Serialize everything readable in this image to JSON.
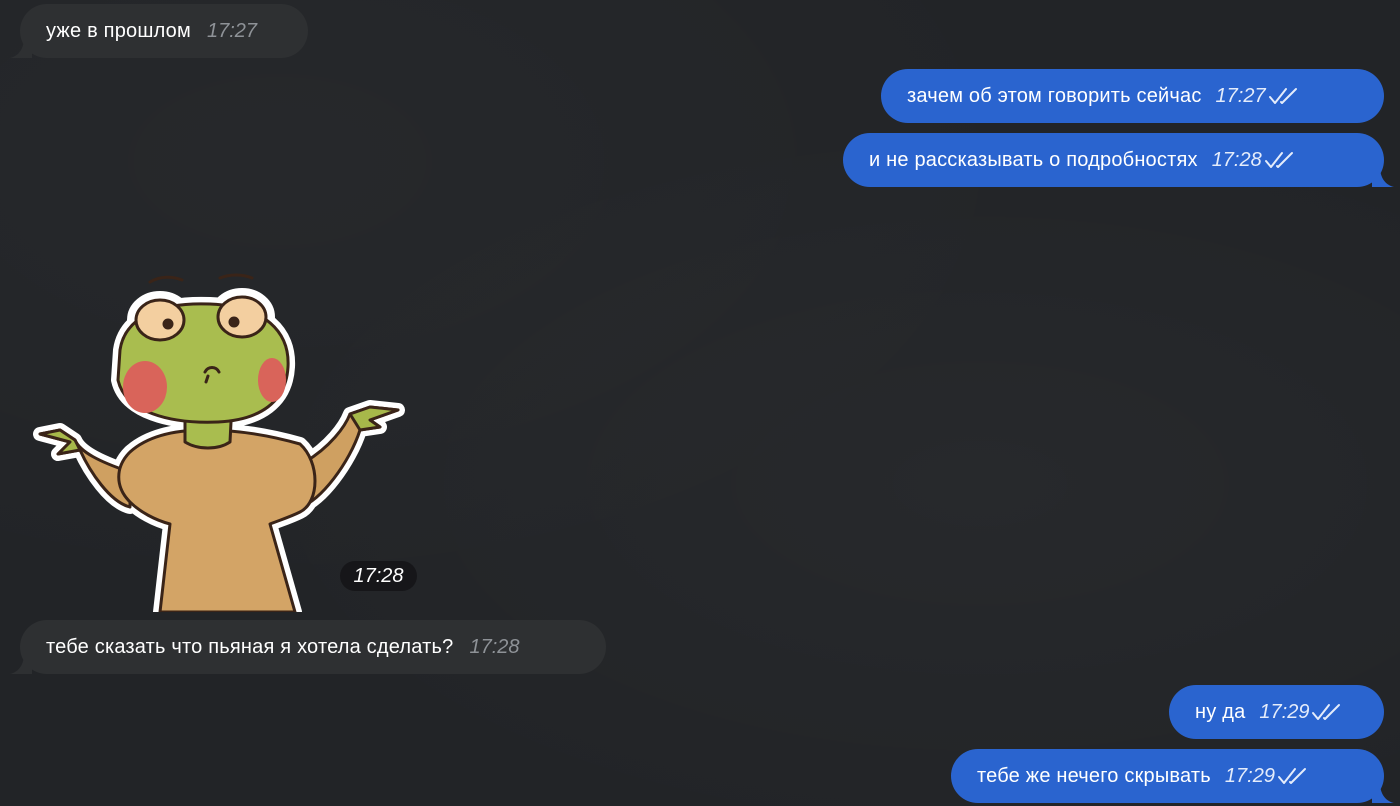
{
  "chat": {
    "messages": [
      {
        "id": "m1",
        "direction": "incoming",
        "type": "text",
        "text": "уже в прошлом",
        "time": "17:27"
      },
      {
        "id": "m2",
        "direction": "outgoing",
        "type": "text",
        "text": "зачем об этом говорить сейчас",
        "time": "17:27",
        "status": "read"
      },
      {
        "id": "m3",
        "direction": "outgoing",
        "type": "text",
        "text": "и не рассказывать о подробностях",
        "time": "17:28",
        "status": "read"
      },
      {
        "id": "m4",
        "direction": "incoming",
        "type": "sticker",
        "sticker": "frog-shrug-sticker",
        "time": "17:28"
      },
      {
        "id": "m5",
        "direction": "incoming",
        "type": "text",
        "text": "тебе сказать что пьяная я хотела сделать?",
        "time": "17:28"
      },
      {
        "id": "m6",
        "direction": "outgoing",
        "type": "text",
        "text": "ну да",
        "time": "17:29",
        "status": "read"
      },
      {
        "id": "m7",
        "direction": "outgoing",
        "type": "text",
        "text": "тебе же нечего скрывать",
        "time": "17:29",
        "status": "read"
      }
    ]
  },
  "colors": {
    "background": "#222427",
    "incoming_bubble": "#2e3032",
    "outgoing_bubble": "#2a64cf",
    "incoming_time": "#8e9297"
  },
  "icons": {
    "read_status": "double-check-icon"
  }
}
